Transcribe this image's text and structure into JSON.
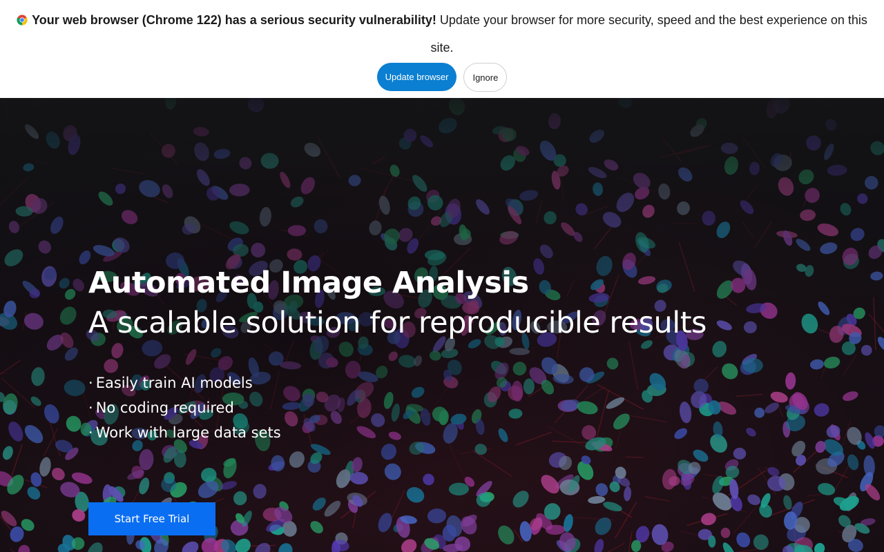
{
  "banner": {
    "icon": "chrome-logo-icon",
    "strong_text": "Your web browser (Chrome 122) has a serious security vulnerability!",
    "message_text": " Update your browser for more security, speed and the best experience on this site.",
    "update_label": "Update browser",
    "ignore_label": "Ignore"
  },
  "hero": {
    "title": "Automated Image Analysis",
    "subtitle": "A scalable solution for reproducible results",
    "bullets": [
      "Easily train AI models",
      "No coding required",
      "Work with large data sets"
    ],
    "bullet_marker": "·",
    "cta_label": "Start Free Trial"
  },
  "colors": {
    "update_button": "#0b7fd1",
    "cta_button": "#0a6ef2",
    "hero_background": "#121214"
  }
}
